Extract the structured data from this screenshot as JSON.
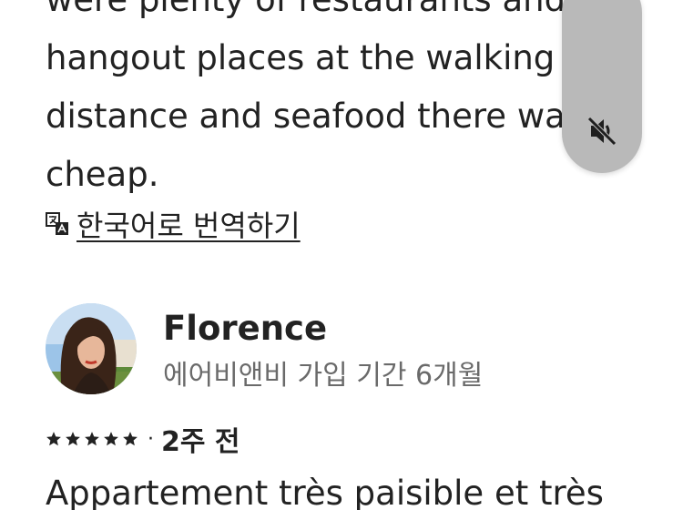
{
  "review_text": {
    "lines": [
      "were plenty of restaurants and",
      "hangout places at the walking",
      "distance and seafood there was",
      "cheap."
    ]
  },
  "translate": {
    "icon": "translate-icon",
    "label": "한국어로 번역하기"
  },
  "reviewer": {
    "name": "Florence",
    "tenure": "에어비앤비 가입 기간 6개월",
    "avatar": "avatar-photo"
  },
  "rating": {
    "stars": 5,
    "separator": "·",
    "date": "2주 전"
  },
  "next_review": {
    "text": "Appartement très paisible et très"
  },
  "mute_button": {
    "icon": "speaker-muted-icon",
    "color": "#b9b9b9"
  },
  "colors": {
    "text": "#222222",
    "secondary": "#6a6a6a"
  }
}
